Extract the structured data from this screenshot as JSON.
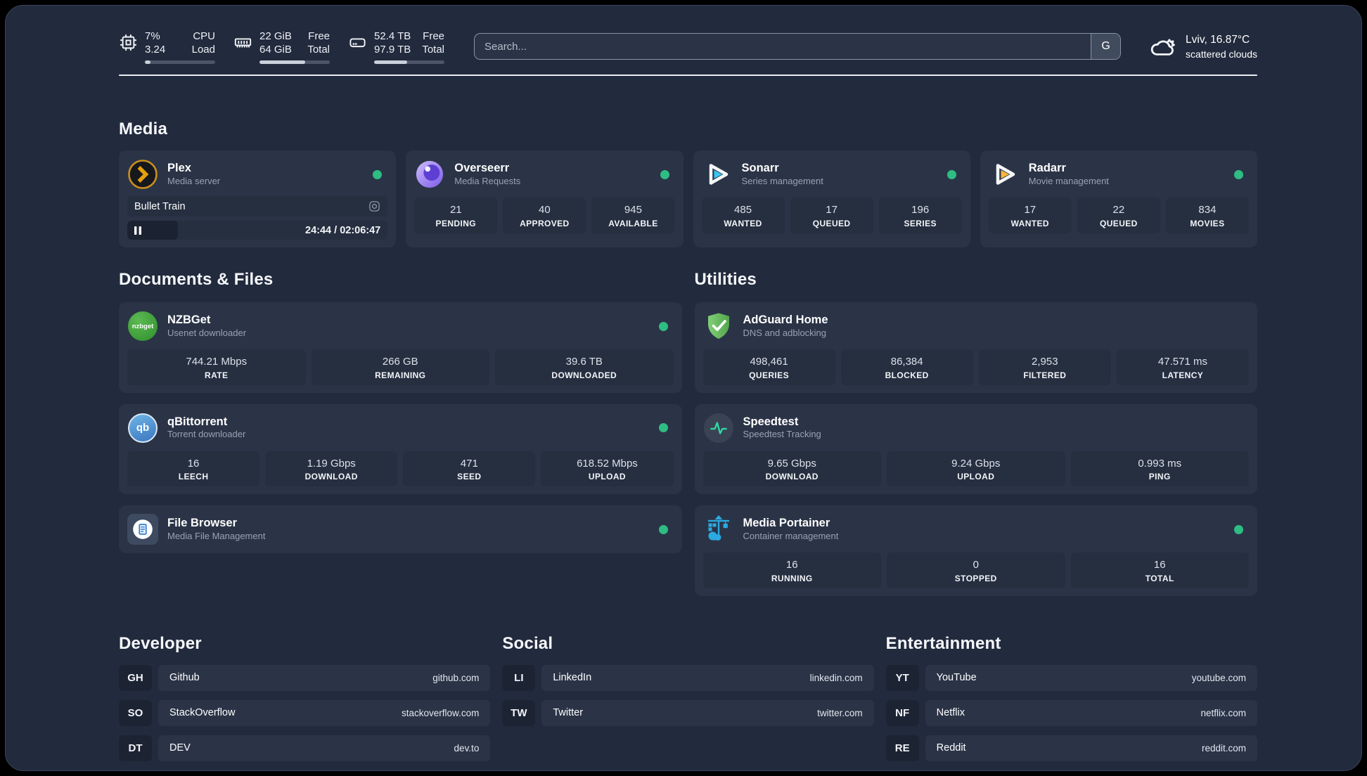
{
  "topbar": {
    "cpu": {
      "value_primary": "7%",
      "value_secondary": "3.24",
      "label_primary": "CPU",
      "label_secondary": "Load",
      "progress_style": "width:8%"
    },
    "memory": {
      "value_primary": "22 GiB",
      "value_secondary": "64 GiB",
      "label_primary": "Free",
      "label_secondary": "Total",
      "progress_style": "width:65%"
    },
    "disk": {
      "value_primary": "52.4 TB",
      "value_secondary": "97.9 TB",
      "label_primary": "Free",
      "label_secondary": "Total",
      "progress_style": "width:47%"
    },
    "search": {
      "placeholder": "Search...",
      "engine_button": "G"
    },
    "weather": {
      "location": "Lviv, 16.87°C",
      "condition": "scattered clouds"
    }
  },
  "media": {
    "title": "Media",
    "plex": {
      "title": "Plex",
      "subtitle": "Media server",
      "now_playing": "Bullet Train",
      "time_display": "24:44 / 02:06:47",
      "progress_style": "width:19.5%"
    },
    "overseerr": {
      "title": "Overseerr",
      "subtitle": "Media Requests",
      "stats": [
        {
          "value": "21",
          "label": "PENDING"
        },
        {
          "value": "40",
          "label": "APPROVED"
        },
        {
          "value": "945",
          "label": "AVAILABLE"
        }
      ]
    },
    "sonarr": {
      "title": "Sonarr",
      "subtitle": "Series management",
      "stats": [
        {
          "value": "485",
          "label": "WANTED"
        },
        {
          "value": "17",
          "label": "QUEUED"
        },
        {
          "value": "196",
          "label": "SERIES"
        }
      ]
    },
    "radarr": {
      "title": "Radarr",
      "subtitle": "Movie management",
      "stats": [
        {
          "value": "17",
          "label": "WANTED"
        },
        {
          "value": "22",
          "label": "QUEUED"
        },
        {
          "value": "834",
          "label": "MOVIES"
        }
      ]
    }
  },
  "documents": {
    "title": "Documents & Files",
    "nzbget": {
      "title": "NZBGet",
      "subtitle": "Usenet downloader",
      "logo_text": "nzbget",
      "stats": [
        {
          "value": "744.21 Mbps",
          "label": "RATE"
        },
        {
          "value": "266 GB",
          "label": "REMAINING"
        },
        {
          "value": "39.6 TB",
          "label": "DOWNLOADED"
        }
      ]
    },
    "qbittorrent": {
      "title": "qBittorrent",
      "subtitle": "Torrent downloader",
      "logo_text": "qb",
      "stats": [
        {
          "value": "16",
          "label": "LEECH"
        },
        {
          "value": "1.19 Gbps",
          "label": "DOWNLOAD"
        },
        {
          "value": "471",
          "label": "SEED"
        },
        {
          "value": "618.52 Mbps",
          "label": "UPLOAD"
        }
      ]
    },
    "filebrowser": {
      "title": "File Browser",
      "subtitle": "Media File Management"
    }
  },
  "utilities": {
    "title": "Utilities",
    "adguard": {
      "title": "AdGuard Home",
      "subtitle": "DNS and adblocking",
      "stats": [
        {
          "value": "498,461",
          "label": "QUERIES"
        },
        {
          "value": "86,384",
          "label": "BLOCKED"
        },
        {
          "value": "2,953",
          "label": "FILTERED"
        },
        {
          "value": "47.571 ms",
          "label": "LATENCY"
        }
      ]
    },
    "speedtest": {
      "title": "Speedtest",
      "subtitle": "Speedtest Tracking",
      "stats": [
        {
          "value": "9.65 Gbps",
          "label": "DOWNLOAD"
        },
        {
          "value": "9.24 Gbps",
          "label": "UPLOAD"
        },
        {
          "value": "0.993 ms",
          "label": "PING"
        }
      ]
    },
    "portainer": {
      "title": "Media Portainer",
      "subtitle": "Container management",
      "stats": [
        {
          "value": "16",
          "label": "RUNNING"
        },
        {
          "value": "0",
          "label": "STOPPED"
        },
        {
          "value": "16",
          "label": "TOTAL"
        }
      ]
    }
  },
  "links": {
    "developer": {
      "title": "Developer",
      "items": [
        {
          "abbr": "GH",
          "name": "Github",
          "domain": "github.com"
        },
        {
          "abbr": "SO",
          "name": "StackOverflow",
          "domain": "stackoverflow.com"
        },
        {
          "abbr": "DT",
          "name": "DEV",
          "domain": "dev.to"
        }
      ]
    },
    "social": {
      "title": "Social",
      "items": [
        {
          "abbr": "LI",
          "name": "LinkedIn",
          "domain": "linkedin.com"
        },
        {
          "abbr": "TW",
          "name": "Twitter",
          "domain": "twitter.com"
        }
      ]
    },
    "entertainment": {
      "title": "Entertainment",
      "items": [
        {
          "abbr": "YT",
          "name": "YouTube",
          "domain": "youtube.com"
        },
        {
          "abbr": "NF",
          "name": "Netflix",
          "domain": "netflix.com"
        },
        {
          "abbr": "RE",
          "name": "Reddit",
          "domain": "reddit.com"
        }
      ]
    }
  },
  "colors": {
    "background": "#222A3D",
    "card": "#2B3447",
    "inner_box": "#262F40",
    "status_online": "#2EBD83",
    "plex_gold": "#E5A00D",
    "sonarr_blue": "#38C6F4",
    "radarr_yellow": "#FFB73B",
    "nzbget_green": "#3FA33C",
    "qbittorrent_blue": "#4C7EC9",
    "overseerr_purple": "#7B5BE6",
    "adguard_green": "#5FB65A",
    "portainer_blue": "#2BAAE2",
    "speedtest_green": "#2FD8A2"
  }
}
